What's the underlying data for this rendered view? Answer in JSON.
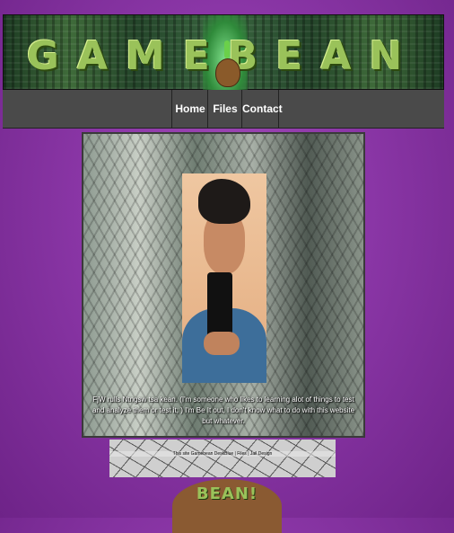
{
  "header": {
    "logo_text": "GAMEBEAN"
  },
  "nav": {
    "items": [
      {
        "label": "Home"
      },
      {
        "label": "Files"
      },
      {
        "label": "Contact"
      }
    ]
  },
  "profile": {
    "bio": "FjW rulls Ntngsw tsa kean. (I'm someone who likes to learning alot of things to test and analyze them or test it; ) I'm Be It out, I don't know what to do with this website but whatever."
  },
  "footer": {
    "text": "This site Gamebean DeskBlue | Files | Jail Design"
  },
  "mascot": {
    "label": "BEAN!"
  },
  "colors": {
    "background": "#8a36a6",
    "nav": "#4a4a4a",
    "logo": "#9ac25a"
  }
}
